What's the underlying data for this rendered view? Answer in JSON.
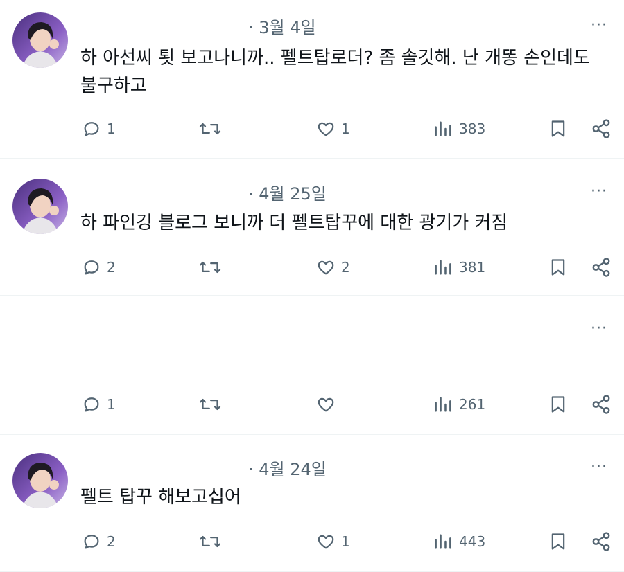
{
  "posts": [
    {
      "meta": "· 3월 4일",
      "more": "···",
      "text": "하 아선씨 툇 보고나니까.. 펠트탑로더? 좀 솔깃해. 난 개똥 손인데도 불구하고",
      "replies": "1",
      "reposts": "",
      "likes": "1",
      "views": "383"
    },
    {
      "meta": "· 4월 25일",
      "more": "···",
      "text": "하 파인깅 블로그 보니까 더 펠트탑꾸에 대한 광기가 커짐",
      "replies": "2",
      "reposts": "",
      "likes": "2",
      "views": "381"
    },
    {
      "meta": "",
      "more": "···",
      "text": "",
      "replies": "1",
      "reposts": "",
      "likes": "",
      "views": "261"
    },
    {
      "meta": "· 4월 24일",
      "more": "···",
      "text": "펠트 탑꾸 해보고십어",
      "replies": "2",
      "reposts": "",
      "likes": "1",
      "views": "443"
    }
  ],
  "icons": {
    "reply": "reply-icon",
    "repost": "repost-icon",
    "like": "like-icon",
    "views": "views-icon",
    "bookmark": "bookmark-icon",
    "share": "share-icon"
  },
  "colors": {
    "text": "#0f1419",
    "muted": "#536471",
    "divider": "#eff3f4",
    "avatar_bg": "#6b4fa0"
  }
}
